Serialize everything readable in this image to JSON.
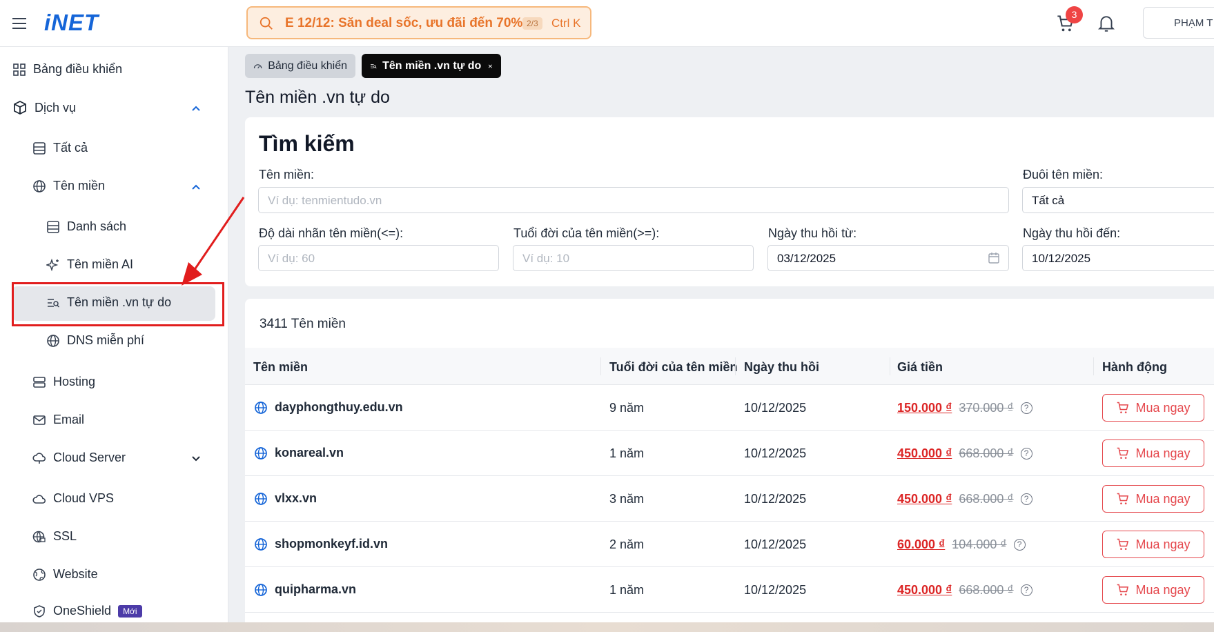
{
  "header": {
    "logo": "iNET",
    "promo_text": "E 12/12: Săn deal sốc, ưu đãi đến 70%",
    "promo_page": "2/3",
    "shortcut": "Ctrl K",
    "cart_count": "3",
    "user_name": "PHẠM T"
  },
  "sidebar": {
    "dashboard": "Bảng điều khiển",
    "services": "Dịch vụ",
    "all": "Tất cả",
    "domains": "Tên miền",
    "list": "Danh sách",
    "ai_domains": "Tên miền AI",
    "free_vn": "Tên miền .vn tự do",
    "free_dns": "DNS miễn phí",
    "hosting": "Hosting",
    "email": "Email",
    "cloud_server": "Cloud Server",
    "cloud_vps": "Cloud VPS",
    "ssl": "SSL",
    "website": "Website",
    "oneshield": "OneShield",
    "new_badge": "Mới"
  },
  "tabs": {
    "dashboard": "Bảng điều khiển",
    "free_vn": "Tên miền .vn tự do"
  },
  "page_title": "Tên miền .vn tự do",
  "search_form": {
    "heading": "Tìm kiếm",
    "domain_label": "Tên miền:",
    "domain_placeholder": "Ví dụ: tenmientudo.vn",
    "ext_label": "Đuôi tên miền:",
    "ext_value": "Tất cả",
    "length_label": "Độ dài nhãn tên miền(<=):",
    "length_placeholder": "Ví dụ: 60",
    "age_label": "Tuổi đời của tên miền(>=):",
    "age_placeholder": "Ví dụ: 10",
    "from_label": "Ngày thu hồi từ:",
    "from_value": "03/12/2025",
    "to_label": "Ngày thu hồi đến:",
    "to_value": "10/12/2025"
  },
  "results": {
    "count": "3411 Tên miền",
    "columns": [
      "Tên miền",
      "Tuổi đời của tên miền",
      "Ngày thu hồi",
      "Giá tiền",
      "Hành động"
    ],
    "buy_label": "Mua ngay",
    "rows": [
      {
        "domain": "dayphongthuy.edu.vn",
        "age": "9 năm",
        "date": "10/12/2025",
        "price": "150.000 ₫",
        "old_price": "370.000 ₫"
      },
      {
        "domain": "konareal.vn",
        "age": "1 năm",
        "date": "10/12/2025",
        "price": "450.000 ₫",
        "old_price": "668.000 ₫"
      },
      {
        "domain": "vlxx.vn",
        "age": "3 năm",
        "date": "10/12/2025",
        "price": "450.000 ₫",
        "old_price": "668.000 ₫"
      },
      {
        "domain": "shopmonkeyf.id.vn",
        "age": "2 năm",
        "date": "10/12/2025",
        "price": "60.000 ₫",
        "old_price": "104.000 ₫"
      },
      {
        "domain": "quipharma.vn",
        "age": "1 năm",
        "date": "10/12/2025",
        "price": "450.000 ₫",
        "old_price": "668.000 ₫"
      }
    ]
  },
  "colors": {
    "accent": "#1565d8",
    "price": "#dc2626",
    "highlight": "#e11d1d",
    "promo": "#e8742a"
  }
}
